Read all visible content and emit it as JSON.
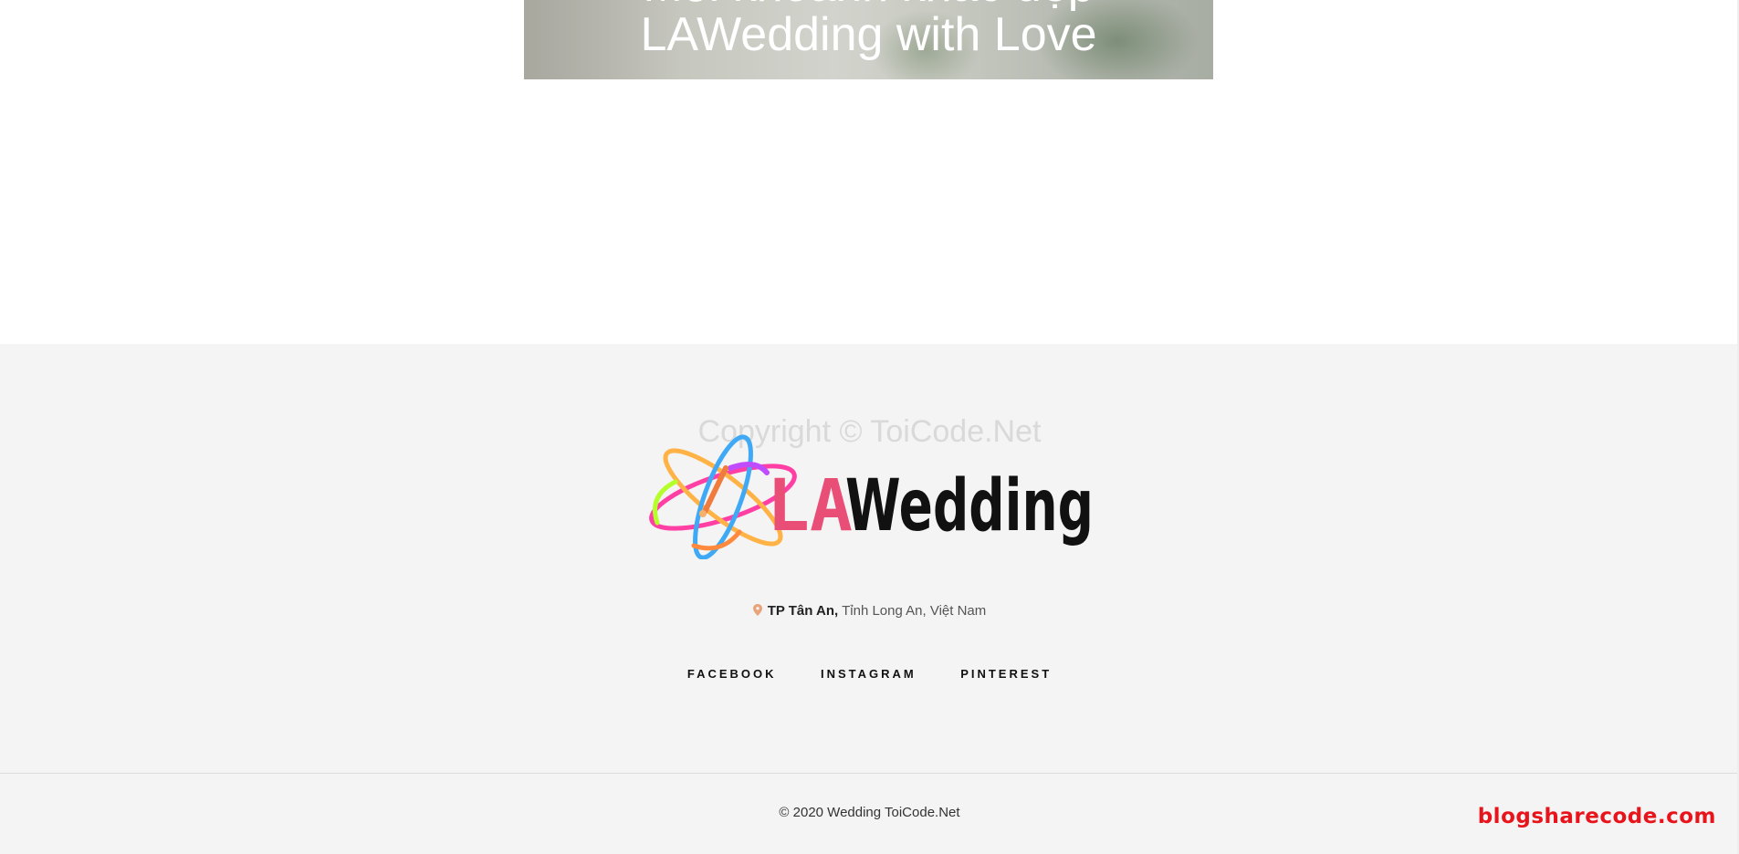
{
  "hero": {
    "top_line": "Mỗi khoảnh khắc đẹp",
    "title": "LAWedding with Love"
  },
  "footer": {
    "watermark": "Copyright © ToiCode.Net",
    "logo": {
      "text_la": "LA",
      "text_wedding": "Wedding",
      "colors": {
        "la": "#e94e77",
        "wedding": "#111111"
      }
    },
    "address": {
      "icon": "map-pin-icon",
      "city": "TP Tân An,",
      "rest": " Tỉnh Long An, Việt Nam"
    },
    "social": [
      {
        "label": "FACEBOOK"
      },
      {
        "label": "INSTAGRAM"
      },
      {
        "label": "PINTEREST"
      }
    ],
    "copyright": "© 2020 Wedding ToiCode.Net",
    "site_watermark": "blogsharecode.com"
  },
  "colors": {
    "footer_bg": "#f4f4f4",
    "pin": "#e8a37a",
    "watermark_red": "#e8141c"
  }
}
